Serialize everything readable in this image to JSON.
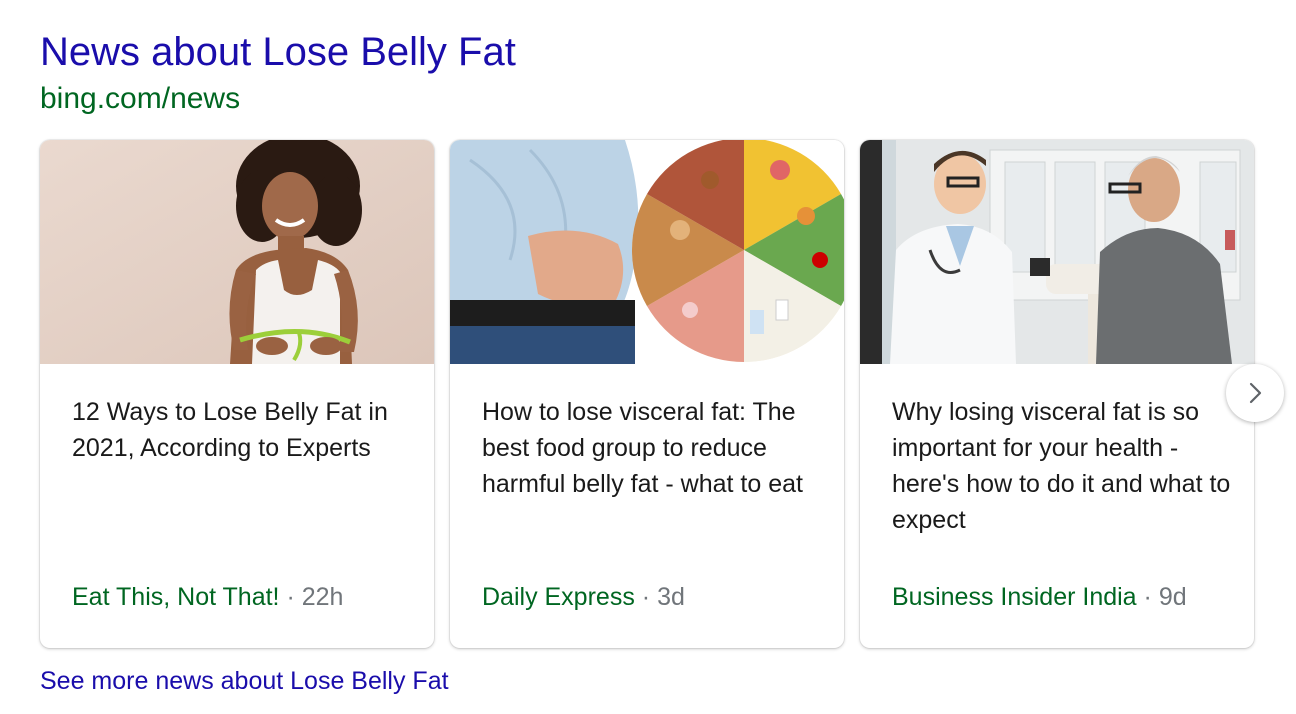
{
  "header": {
    "title": "News about Lose Belly Fat",
    "domain": "bing.com/news"
  },
  "cards": [
    {
      "headline": "12 Ways to Lose Belly Fat in 2021, According to Experts",
      "source": "Eat This, Not That!",
      "separator": "·",
      "age": "22h",
      "image": "woman-measuring-waist-photo"
    },
    {
      "headline": "How to lose visceral fat: The best food group to reduce harmful belly fat - what to eat",
      "source": "Daily Express",
      "separator": "·",
      "age": "3d",
      "image": "belly-and-food-wheel-photo"
    },
    {
      "headline": "Why losing visceral fat is so important for your health - here's how to do it and what to expect",
      "source": "Business Insider India",
      "separator": "·",
      "age": "9d",
      "image": "doctor-weighing-patient-photo"
    }
  ],
  "carousel": {
    "next_icon": "chevron-right-icon"
  },
  "footer": {
    "more_link": "See more news about Lose Belly Fat"
  },
  "colors": {
    "title_link": "#1a0dab",
    "url_green": "#006621",
    "meta_gray": "#70757a",
    "text": "#1a1a1a"
  }
}
